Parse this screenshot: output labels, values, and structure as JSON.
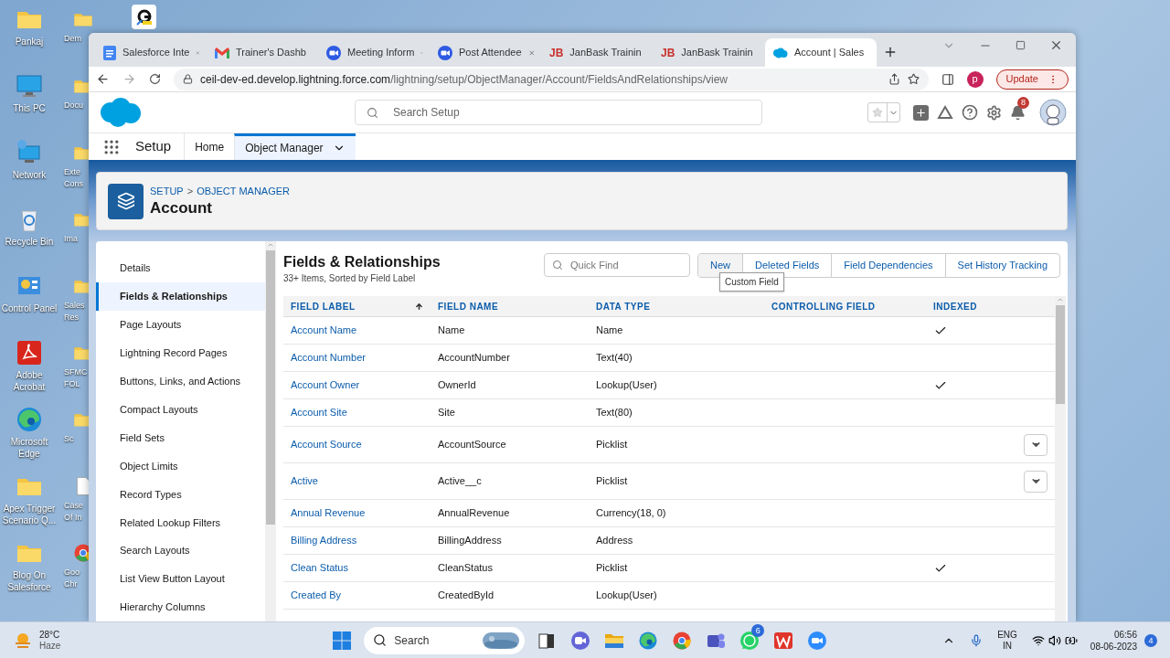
{
  "desktop": {
    "icons": [
      {
        "label": "Pankaj",
        "kind": "folder"
      },
      {
        "label": "This PC",
        "kind": "monitor"
      },
      {
        "label": "Network",
        "kind": "network"
      },
      {
        "label": "Recycle Bin",
        "kind": "recycle"
      },
      {
        "label": "Control Panel",
        "kind": "control"
      },
      {
        "label": "Adobe Acrobat",
        "kind": "pdf"
      },
      {
        "label": "Microsoft Edge",
        "kind": "edge"
      },
      {
        "label": "Apex Trigger Scenario Q...",
        "kind": "folder"
      },
      {
        "label": "Blog On Salesforce",
        "kind": "folder"
      }
    ],
    "icons_2": [
      {
        "label": "Dem",
        "kind": "folder"
      },
      {
        "label": "Docu",
        "kind": "folder"
      },
      {
        "label": "Exte Cons",
        "kind": "folder"
      },
      {
        "label": "Ima",
        "kind": "folder"
      },
      {
        "label": "Sales Res",
        "kind": "folder"
      },
      {
        "label": "SFMC FOL",
        "kind": "folder"
      },
      {
        "label": "Sc",
        "kind": "folder"
      },
      {
        "label": "Case Of In",
        "kind": "doc"
      },
      {
        "label": "Goo Chr",
        "kind": "chrome"
      }
    ]
  },
  "browser": {
    "tabs": [
      {
        "title": "Salesforce Inte",
        "kind": "docs",
        "selected": false
      },
      {
        "title": "Trainer's Dashb",
        "kind": "gmail",
        "selected": false
      },
      {
        "title": "Meeting Inform",
        "kind": "zoom",
        "selected": false
      },
      {
        "title": "Post Attendee",
        "kind": "zoom",
        "selected": false
      },
      {
        "title": "JanBask Trainin",
        "kind": "jb",
        "icon_text": "JB",
        "selected": false
      },
      {
        "title": "JanBask Trainin",
        "kind": "jb",
        "icon_text": "JB",
        "selected": false
      },
      {
        "title": "Account | Sales",
        "kind": "salesforce",
        "selected": true
      }
    ],
    "url_host": "ceil-dev-ed.develop.lightning.force.com",
    "url_path": "/lightning/setup/ObjectManager/Account/FieldsAndRelationships/view",
    "profile": "p",
    "update": "Update"
  },
  "header": {
    "search_placeholder": "Search Setup",
    "notifications": "8"
  },
  "nav": {
    "app": "Setup",
    "tabs": [
      {
        "label": "Home",
        "selected": false,
        "dropdown": false
      },
      {
        "label": "Object Manager",
        "selected": true,
        "dropdown": true
      }
    ]
  },
  "page_header": {
    "breadcrumb": [
      "SETUP",
      "OBJECT MANAGER"
    ],
    "separator": ">",
    "title": "Account"
  },
  "sidebar": {
    "items": [
      {
        "label": "Details",
        "selected": false
      },
      {
        "label": "Fields & Relationships",
        "selected": true
      },
      {
        "label": "Page Layouts",
        "selected": false
      },
      {
        "label": "Lightning Record Pages",
        "selected": false
      },
      {
        "label": "Buttons, Links, and Actions",
        "selected": false
      },
      {
        "label": "Compact Layouts",
        "selected": false
      },
      {
        "label": "Field Sets",
        "selected": false
      },
      {
        "label": "Object Limits",
        "selected": false
      },
      {
        "label": "Record Types",
        "selected": false
      },
      {
        "label": "Related Lookup Filters",
        "selected": false
      },
      {
        "label": "Search Layouts",
        "selected": false
      },
      {
        "label": "List View Button Layout",
        "selected": false
      },
      {
        "label": "Hierarchy Columns",
        "selected": false
      }
    ]
  },
  "fields": {
    "title": "Fields & Relationships",
    "subtitle": "33+ Items, Sorted by Field Label",
    "search_placeholder": "Quick Find",
    "buttons": [
      "New",
      "Deleted Fields",
      "Field Dependencies",
      "Set History Tracking"
    ],
    "tooltip": "Custom Field",
    "columns": [
      {
        "label": "FIELD LABEL",
        "sorted": true
      },
      {
        "label": "FIELD NAME",
        "sorted": false
      },
      {
        "label": "DATA TYPE",
        "sorted": false
      },
      {
        "label": "CONTROLLING FIELD",
        "sorted": false
      },
      {
        "label": "INDEXED",
        "sorted": false
      }
    ],
    "rows": [
      {
        "label": "Account Name",
        "name": "Name",
        "type": "Name",
        "indexed": true,
        "menu": false
      },
      {
        "label": "Account Number",
        "name": "AccountNumber",
        "type": "Text(40)",
        "indexed": false,
        "menu": false
      },
      {
        "label": "Account Owner",
        "name": "OwnerId",
        "type": "Lookup(User)",
        "indexed": true,
        "menu": false
      },
      {
        "label": "Account Site",
        "name": "Site",
        "type": "Text(80)",
        "indexed": false,
        "menu": false
      },
      {
        "label": "Account Source",
        "name": "AccountSource",
        "type": "Picklist",
        "indexed": false,
        "menu": true
      },
      {
        "label": "Active",
        "name": "Active__c",
        "type": "Picklist",
        "indexed": false,
        "menu": true
      },
      {
        "label": "Annual Revenue",
        "name": "AnnualRevenue",
        "type": "Currency(18, 0)",
        "indexed": false,
        "menu": false
      },
      {
        "label": "Billing Address",
        "name": "BillingAddress",
        "type": "Address",
        "indexed": false,
        "menu": false
      },
      {
        "label": "Clean Status",
        "name": "CleanStatus",
        "type": "Picklist",
        "indexed": true,
        "menu": false
      },
      {
        "label": "Created By",
        "name": "CreatedById",
        "type": "Lookup(User)",
        "indexed": false,
        "menu": false
      }
    ]
  },
  "taskbar": {
    "temperature": "28°C",
    "weather": "Haze",
    "search_placeholder": "Search",
    "apps": [
      {
        "kind": "taskview"
      },
      {
        "kind": "meet"
      },
      {
        "kind": "folder"
      },
      {
        "kind": "edge"
      },
      {
        "kind": "chrome"
      },
      {
        "kind": "teams"
      },
      {
        "kind": "whatsapp",
        "badge": "6"
      },
      {
        "kind": "office"
      },
      {
        "kind": "zoom"
      }
    ],
    "language": "ENG",
    "region": "IN",
    "time": "06:56",
    "date": "08-06-2023",
    "notifications": "4"
  }
}
